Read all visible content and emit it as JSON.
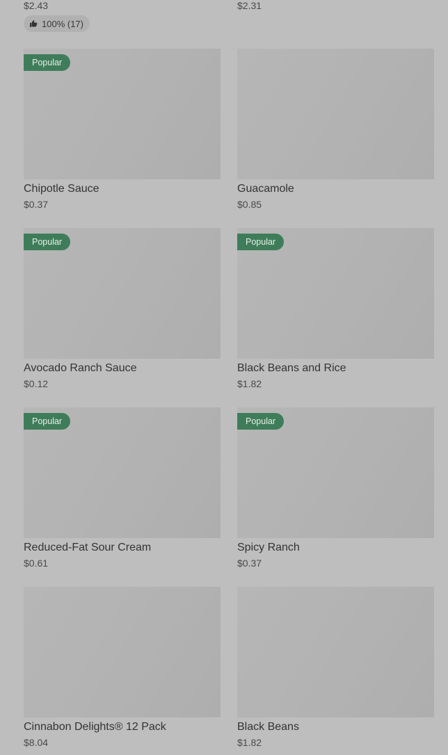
{
  "top": {
    "left_price": "$2.43",
    "right_price": "$2.31",
    "rating": "100% (17)"
  },
  "colors": {
    "badge": "#3f7d5a",
    "background": "#bebebe"
  },
  "items": [
    {
      "name": "Chipotle Sauce",
      "price": "$0.37",
      "badge": "Popular"
    },
    {
      "name": "Guacamole",
      "price": "$0.85",
      "badge": ""
    },
    {
      "name": "Avocado Ranch Sauce",
      "price": "$0.12",
      "badge": "Popular"
    },
    {
      "name": "Black Beans and Rice",
      "price": "$1.82",
      "badge": "Popular"
    },
    {
      "name": "Reduced-Fat Sour Cream",
      "price": "$0.61",
      "badge": "Popular"
    },
    {
      "name": "Spicy Ranch",
      "price": "$0.37",
      "badge": "Popular"
    },
    {
      "name": "Cinnabon Delights® 12 Pack",
      "price": "$8.04",
      "badge": ""
    },
    {
      "name": "Black Beans",
      "price": "$1.82",
      "badge": ""
    }
  ]
}
